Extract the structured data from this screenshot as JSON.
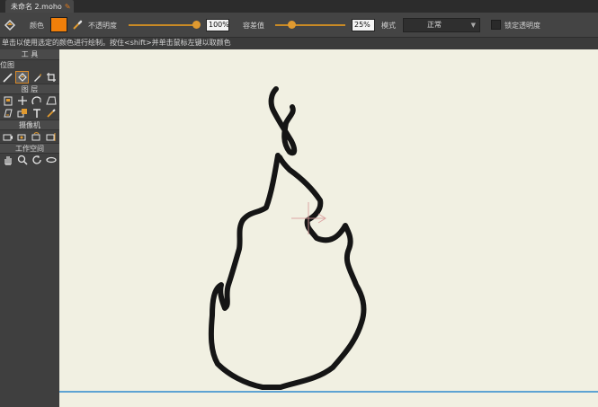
{
  "tab": {
    "title": "未命名 2.moho"
  },
  "options": {
    "color_label": "颜色",
    "color_value": "#f07f0a",
    "opacity_label": "不透明度",
    "opacity_value": "100%",
    "tolerance_label": "容差值",
    "tolerance_value": "25%",
    "mode_label": "模式",
    "mode_value": "正常",
    "lock_opacity_label": "锁定透明度"
  },
  "status": {
    "hint": "单击以使用选定的颜色进行绘制。按住<shift>并单击鼠标左键以取颜色"
  },
  "tools_panel": {
    "title": "工 具",
    "bitmap_section": "位图",
    "layers_section": "图 层",
    "camera_section": "摄像机",
    "workspace_section": "工作空间",
    "bitmap_tools": [
      {
        "name": "brush-tool-icon",
        "selected": false
      },
      {
        "name": "paint-bucket-tool-icon",
        "selected": true
      },
      {
        "name": "eraser-tool-icon",
        "selected": false
      },
      {
        "name": "crop-tool-icon",
        "selected": false
      }
    ],
    "layer_tools_row1": [
      "layer-select-icon",
      "translate-layer-icon",
      "rotate-layer-icon",
      "shear-layer-icon"
    ],
    "layer_tools_row2": [
      "scale-layer-icon",
      "layer-arrange-icon",
      "text-tool-icon",
      "eyedropper-tool-icon"
    ],
    "camera_tools": [
      "camera-track-icon",
      "camera-zoom-icon",
      "camera-roll-icon",
      "camera-pan-tilt-icon"
    ],
    "workspace_tools": [
      "hand-pan-icon",
      "workspace-zoom-icon",
      "workspace-rotate-icon",
      "workspace-orbit-icon"
    ]
  },
  "colors": {
    "canvas_bg": "#f1f0e2",
    "accent": "#e09a30",
    "stroke": "#151515",
    "ground_line": "#5ea3d3"
  }
}
